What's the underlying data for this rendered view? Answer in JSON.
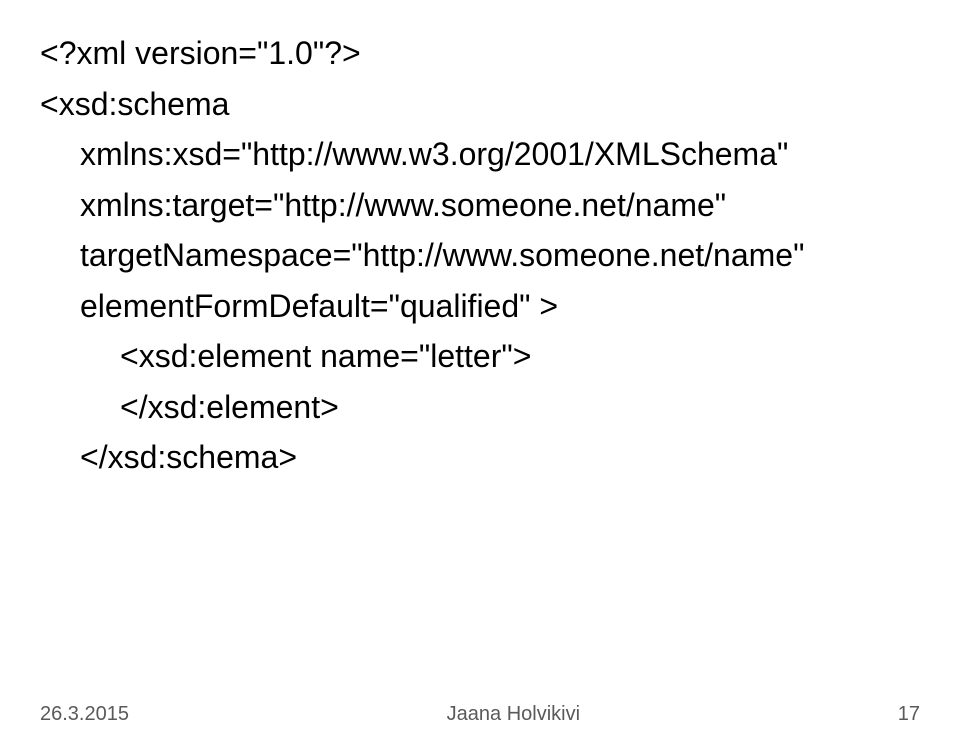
{
  "code": {
    "line1": "<?xml version=\"1.0\"?>",
    "line2": "<xsd:schema",
    "line3": "xmlns:xsd=\"http://www.w3.org/2001/XMLSchema\"",
    "line4": "xmlns:target=\"http://www.someone.net/name\"",
    "line5": "targetNamespace=\"http://www.someone.net/name\"",
    "line6": "elementFormDefault=\"qualified\" >",
    "line7": "<xsd:element name=\"letter\">",
    "line8": "</xsd:element>",
    "line9": "</xsd:schema>"
  },
  "footer": {
    "date": "26.3.2015",
    "author": "Jaana Holvikivi",
    "page": "17"
  }
}
